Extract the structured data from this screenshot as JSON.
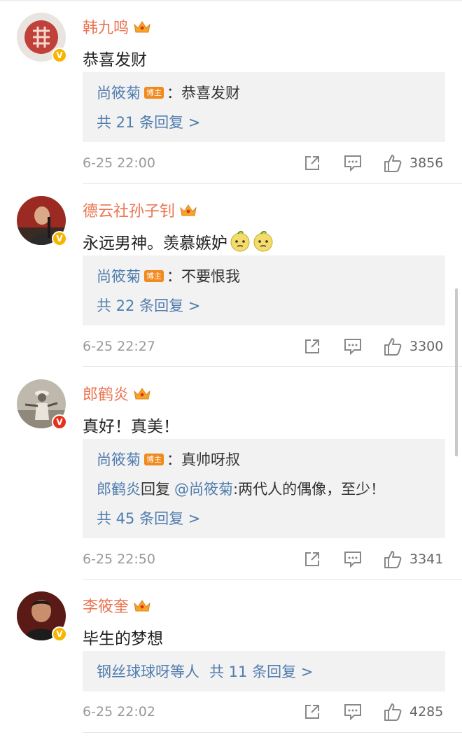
{
  "comments": [
    {
      "username": "韩九鸣",
      "content": "恭喜发财",
      "avatar": "seal-stamp-avatar",
      "verified": "gold",
      "host_reply": {
        "author": "尚筱菊",
        "badge": "博主",
        "text": "：恭喜发财"
      },
      "more_replies": "共 21 条回复 >",
      "time": "6-25 22:00",
      "likes": "3856"
    },
    {
      "username": "德云社孙子钊",
      "content": "永远男神。羡慕嫉妒",
      "emojis": [
        "envy-emoji",
        "envy-emoji"
      ],
      "avatar": "performer-avatar",
      "verified": "gold",
      "host_reply": {
        "author": "尚筱菊",
        "badge": "博主",
        "text": "：不要恨我"
      },
      "more_replies": "共 22 条回复 >",
      "time": "6-25 22:27",
      "likes": "3300"
    },
    {
      "username": "郎鹤炎",
      "content": "真好！真美！",
      "avatar": "vintage-photo-avatar",
      "verified": "red",
      "host_reply": {
        "author": "尚筱菊",
        "badge": "博主",
        "text": "：真帅呀叔"
      },
      "sub_reply": {
        "author": "郎鹤炎",
        "action": "回复",
        "mention": "@尚筱菊",
        "text": ":两代人的偶像，至少！"
      },
      "more_replies": "共 45 条回复 >",
      "time": "6-25 22:50",
      "likes": "3341"
    },
    {
      "username": "李筱奎",
      "content": "毕生的梦想",
      "avatar": "portrait-avatar",
      "verified": "gold",
      "summary": {
        "names": "钢丝球球呀等人",
        "count": "共 11 条回复 >"
      },
      "time": "6-25 22:02",
      "likes": "4285"
    }
  ],
  "badge_glyph": "V",
  "colors": {
    "username": "#eb7350",
    "link": "#507daf",
    "host_badge": "#f08a1e",
    "verified_gold": "#f7b500",
    "verified_red": "#e5301c"
  }
}
